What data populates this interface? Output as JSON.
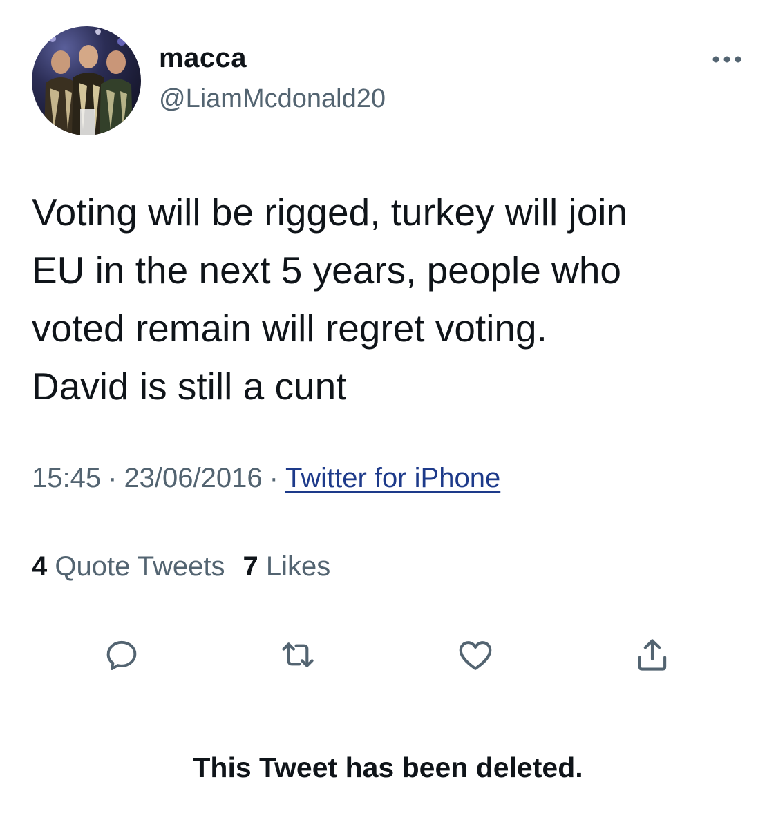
{
  "tweet": {
    "display_name": "macca",
    "handle": "@LiamMcdonald20",
    "text": "Voting will be rigged, turkey will join\nEU in the next 5 years, people who\nvoted remain will regret voting.\nDavid is still a cunt",
    "time": "15:45",
    "date": "23/06/2016",
    "separator": "·",
    "source": "Twitter for iPhone"
  },
  "stats": {
    "quote_count": "4",
    "quote_label": "Quote Tweets",
    "like_count": "7",
    "like_label": "Likes"
  },
  "actions": [
    "reply-icon",
    "retweet-icon",
    "like-icon",
    "share-icon"
  ],
  "notice": "This Tweet has been deleted.",
  "colors": {
    "text": "#0f1419",
    "secondary": "#536471",
    "link": "#1d3a8a",
    "divider": "#cfd9de",
    "background": "#ffffff"
  }
}
